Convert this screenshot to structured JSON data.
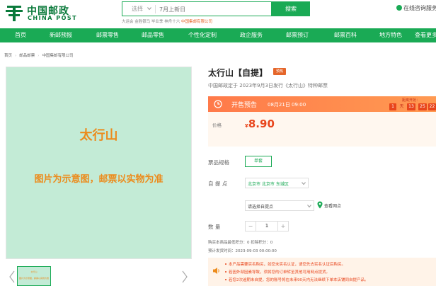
{
  "header": {
    "logo_cn": "中国邮政",
    "logo_en": "CHINA POST",
    "search": {
      "select_label": "选择",
      "placeholder": "7月上新日",
      "button": "搜索"
    },
    "hotwords": {
      "plain": "大运会  金胜银马  毕业季  神舟十六  ",
      "highlight": "中国集邮有限公司"
    },
    "online_service": "在线咨询服务"
  },
  "nav": {
    "items": [
      "首页",
      "新邮预报",
      "邮票零售",
      "邮品零售",
      "个性化定制",
      "政企服务",
      "邮票预订",
      "邮票百科",
      "地方特色",
      "查看更多"
    ]
  },
  "breadcrumb": [
    "首页",
    "邮品邮票",
    "中国集邮有限公司"
  ],
  "gallery": {
    "title": "太行山",
    "note": "图片为示意图，邮票以实物为准",
    "thumb_title": "太行山",
    "thumb_note": "图片为示意图，邮票以实物为准",
    "prev": "〈",
    "next": "〉"
  },
  "product": {
    "title": "太行山【自提】",
    "badge": "预热",
    "subtitle": "中国邮政定于 2023年9月3日发行《太行山》特种邮票",
    "presale": {
      "label": "开售预告",
      "time": "08月21日 09:00",
      "countdown_label": "距离开抢：",
      "countdown": [
        "1",
        "天",
        "13",
        "25",
        "22"
      ]
    },
    "price": {
      "label": "价格",
      "currency": "¥",
      "value": "8.90"
    },
    "spec": {
      "label": "票品规格",
      "option": "单套"
    },
    "region": {
      "label": "自 提 点",
      "value": "北京市 北京市 东城区"
    },
    "pickup": {
      "placeholder": "请选择自提点",
      "view_outlet": "查看网点"
    },
    "quantity": {
      "label": "数    量",
      "minus": "−",
      "value": "1",
      "plus": "+"
    },
    "points": "购买本商品最低积分：0   扣除积分：0",
    "ship_time": "预计发货时间：2023-09-03 00:00:00",
    "notices": [
      "本产品需要实名购买，如您未实名认证，请您先去实名认证后购买。",
      "若因外部因素导致，须将您的订单转至其他可用网点提货。",
      "若您2次逾期未自提，您的账号将在未来90天内无法继续下单本店铺同自提产品。"
    ]
  },
  "colors": {
    "brand_green": "#1aaa55",
    "price_red": "#e8451c",
    "accent_orange": "#ec8b1c"
  }
}
